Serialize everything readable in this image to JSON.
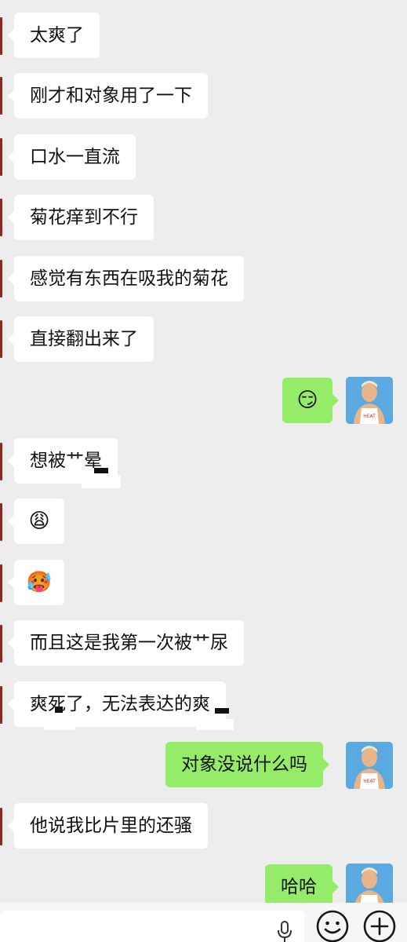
{
  "messages": [
    {
      "text": "太爽了"
    },
    {
      "text": "刚才和对象用了一下"
    },
    {
      "text": "口水一直流"
    },
    {
      "text": "菊花痒到不行"
    },
    {
      "text": "感觉有东西在吸我的菊花"
    },
    {
      "text": "直接翻出来了"
    },
    {
      "text": "😏"
    },
    {
      "text": "想被艹晕"
    },
    {
      "text": "😩"
    },
    {
      "text": "🥵"
    },
    {
      "text": "而且这是我第一次被艹尿"
    },
    {
      "text": "爽死了，无法表达的爽"
    },
    {
      "text": "对象没说什么吗"
    },
    {
      "text": "他说我比片里的还骚"
    },
    {
      "text": "哈哈"
    }
  ],
  "input": {
    "placeholder": "",
    "voice_icon": "microphone-icon",
    "emoji_icon": "smiley-icon",
    "more_icon": "plus-circle-icon"
  },
  "colors": {
    "background": "#ededed",
    "incoming_bubble": "#ffffff",
    "outgoing_bubble": "#95ec69",
    "avatar_bg": "#5aa9e0"
  }
}
